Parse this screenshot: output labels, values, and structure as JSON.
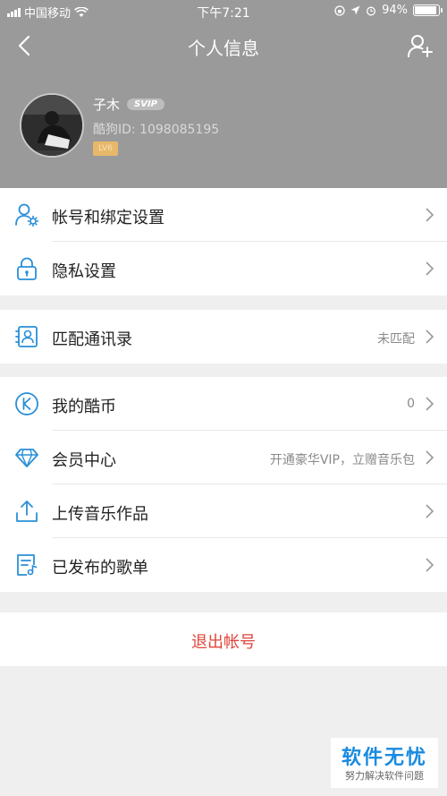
{
  "status_bar": {
    "carrier": "中国移动",
    "time": "下午7:21",
    "battery": "94%",
    "battery_level": 0.94
  },
  "header": {
    "title": "个人信息"
  },
  "profile": {
    "name": "子木",
    "badge": "SVIP",
    "id_text": "酷狗ID: 1098085195",
    "level_badge": "LV6"
  },
  "menu_groups": [
    [
      {
        "icon": "account-settings-icon",
        "label": "帐号和绑定设置",
        "value": ""
      },
      {
        "icon": "lock-icon",
        "label": "隐私设置",
        "value": ""
      }
    ],
    [
      {
        "icon": "contacts-icon",
        "label": "匹配通讯录",
        "value": "未匹配"
      }
    ],
    [
      {
        "icon": "coin-icon",
        "label": "我的酷币",
        "value": "0"
      },
      {
        "icon": "diamond-icon",
        "label": "会员中心",
        "value": "开通豪华VIP，立赠音乐包"
      },
      {
        "icon": "upload-icon",
        "label": "上传音乐作品",
        "value": ""
      },
      {
        "icon": "playlist-icon",
        "label": "已发布的歌单",
        "value": ""
      }
    ]
  ],
  "logout_label": "退出帐号",
  "watermark": {
    "title": "软件无忧",
    "subtitle": "努力解决软件问题"
  },
  "colors": {
    "header_bg": "#9a9a9a",
    "accent_blue": "#2a8fd8",
    "logout_red": "#e0453b"
  }
}
